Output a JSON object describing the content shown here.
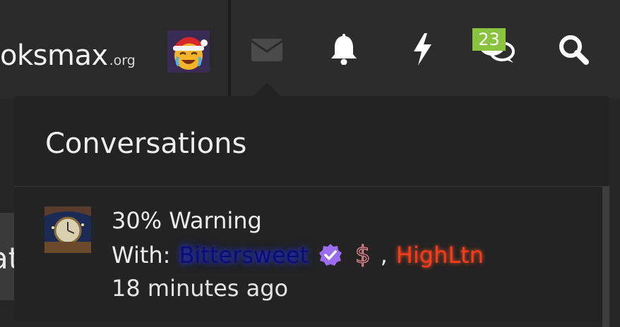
{
  "header": {
    "logo_main": "oksmax",
    "logo_tld": ".org",
    "icons": [
      "envelope-icon",
      "bell-icon",
      "bolt-icon",
      "chat-bubbles-icon",
      "search-icon"
    ],
    "unread_badge": "23",
    "badge_color": "#8ac43f"
  },
  "background": {
    "partial_text": "at"
  },
  "conversations_panel": {
    "title": "Conversations",
    "items": [
      {
        "subject": "30% Warning",
        "with_label": "With:",
        "participants": [
          {
            "name": "Bittersweet",
            "color": "#0b0b7a",
            "badges": [
              "verified-icon",
              "dollar-icon"
            ]
          },
          {
            "name": "HighLtn",
            "color": "#ff3a1a"
          }
        ],
        "separator": ",",
        "time": "18 minutes ago"
      }
    ]
  }
}
